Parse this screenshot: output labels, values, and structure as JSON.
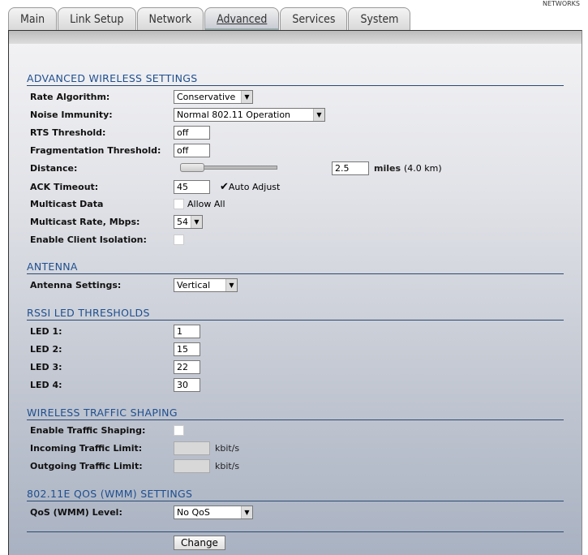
{
  "brand": "NETWORKS",
  "tabs": [
    {
      "label": "Main"
    },
    {
      "label": "Link Setup"
    },
    {
      "label": "Network"
    },
    {
      "label": "Advanced"
    },
    {
      "label": "Services"
    },
    {
      "label": "System"
    }
  ],
  "sections": {
    "advanced": "ADVANCED WIRELESS SETTINGS",
    "antenna": "ANTENNA",
    "rssi": "RSSI LED THRESHOLDS",
    "shaping": "WIRELESS TRAFFIC SHAPING",
    "qos": "802.11E QOS (WMM) SETTINGS"
  },
  "adv": {
    "rate_label": "Rate Algorithm:",
    "rate_value": "Conservative",
    "noise_label": "Noise Immunity:",
    "noise_value": "Normal 802.11 Operation",
    "rts_label": "RTS Threshold:",
    "rts_value": "off",
    "frag_label": "Fragmentation Threshold:",
    "frag_value": "off",
    "distance_label": "Distance:",
    "distance_value": "2.5",
    "distance_unit": "miles",
    "distance_km": "(4.0 km)",
    "ack_label": "ACK Timeout:",
    "ack_value": "45",
    "auto_adjust": "Auto Adjust",
    "mcast_label": "Multicast Data",
    "allow_all": "Allow All",
    "mrate_label": "Multicast Rate, Mbps:",
    "mrate_value": "54",
    "isolation_label": "Enable Client Isolation:"
  },
  "antenna": {
    "label": "Antenna Settings:",
    "value": "Vertical"
  },
  "leds": [
    {
      "label": "LED 1:",
      "value": "1"
    },
    {
      "label": "LED 2:",
      "value": "15"
    },
    {
      "label": "LED 3:",
      "value": "22"
    },
    {
      "label": "LED 4:",
      "value": "30"
    }
  ],
  "shaping": {
    "enable_label": "Enable Traffic Shaping:",
    "in_label": "Incoming Traffic Limit:",
    "out_label": "Outgoing Traffic Limit:",
    "unit": "kbit/s"
  },
  "qos": {
    "label": "QoS (WMM) Level:",
    "value": "No QoS"
  },
  "change": "Change"
}
